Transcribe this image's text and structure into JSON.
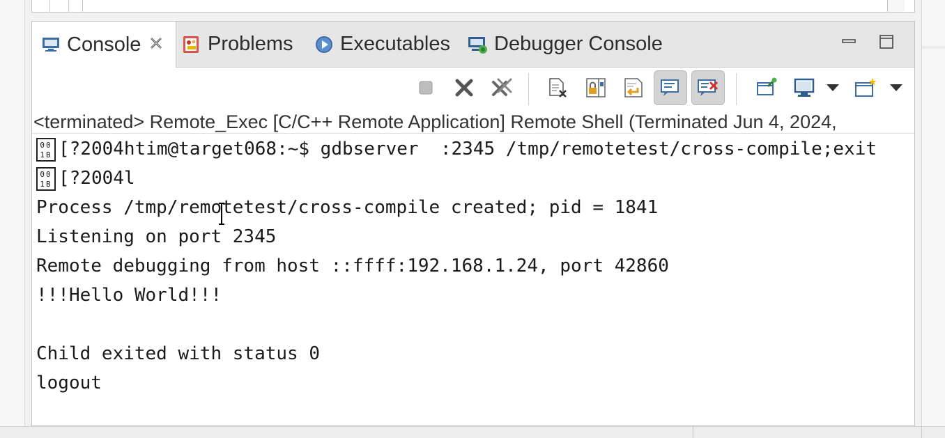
{
  "tabs": [
    {
      "label": "Console",
      "icon": "console-icon",
      "active": true
    },
    {
      "label": "Problems",
      "icon": "problems-icon"
    },
    {
      "label": "Executables",
      "icon": "executables-icon"
    },
    {
      "label": "Debugger Console",
      "icon": "debugger-console-icon"
    }
  ],
  "status_line": "<terminated> Remote_Exec [C/C++ Remote Application] Remote Shell (Terminated Jun 4, 2024,",
  "console": {
    "esc_glyph": "001B",
    "lines": [
      "[?2004htim@target068:~$ gdbserver  :2345 /tmp/remotetest/cross-compile;exit",
      "[?2004l",
      "Process /tmp/remotetest/cross-compile created; pid = 1841",
      "Listening on port 2345",
      "Remote debugging from host ::ffff:192.168.1.24, port 42860",
      "!!!Hello World!!!",
      "",
      "Child exited with status 0",
      "logout"
    ]
  },
  "colors": {
    "tab_bar_bg": "#e6e6e6",
    "active_tab_bg": "#ffffff",
    "console_text": "#1a1a1a",
    "icon_blue": "#3a6ea5"
  }
}
